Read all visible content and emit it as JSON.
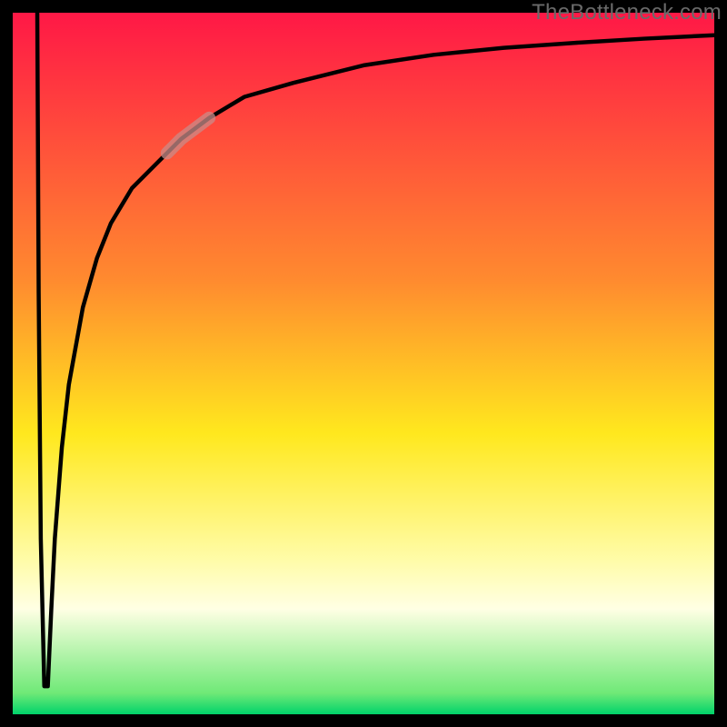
{
  "watermark": "TheBottleneck.com",
  "chart_data": {
    "type": "line",
    "title": "",
    "xlabel": "",
    "ylabel": "",
    "xlim": [
      0,
      100
    ],
    "ylim": [
      0,
      100
    ],
    "grid": false,
    "legend": null,
    "annotations": [],
    "background_gradient_stops": [
      {
        "offset": 0.0,
        "color": "#ff1846"
      },
      {
        "offset": 0.38,
        "color": "#ff8a2f"
      },
      {
        "offset": 0.6,
        "color": "#ffe81e"
      },
      {
        "offset": 0.78,
        "color": "#fffca8"
      },
      {
        "offset": 0.85,
        "color": "#ffffe4"
      },
      {
        "offset": 0.97,
        "color": "#6fe977"
      },
      {
        "offset": 1.0,
        "color": "#00d36a"
      }
    ],
    "curve_color": "#000000",
    "highlight_color": "#c98b88",
    "highlight_range_x": [
      22,
      28
    ],
    "series": [
      {
        "name": "curve",
        "x": [
          3.5,
          3.7,
          4.0,
          4.5,
          5.0,
          5.5,
          6.0,
          7.0,
          8.0,
          10.0,
          12.0,
          14.0,
          17.0,
          20.0,
          24.0,
          28.0,
          33.0,
          40.0,
          50.0,
          60.0,
          70.0,
          80.0,
          90.0,
          100.0
        ],
        "y": [
          100,
          60,
          25,
          4,
          4,
          15,
          25,
          38,
          47,
          58,
          65,
          70,
          75,
          78,
          82,
          85,
          88,
          90,
          92.5,
          94,
          95,
          95.7,
          96.3,
          96.8
        ]
      }
    ]
  }
}
